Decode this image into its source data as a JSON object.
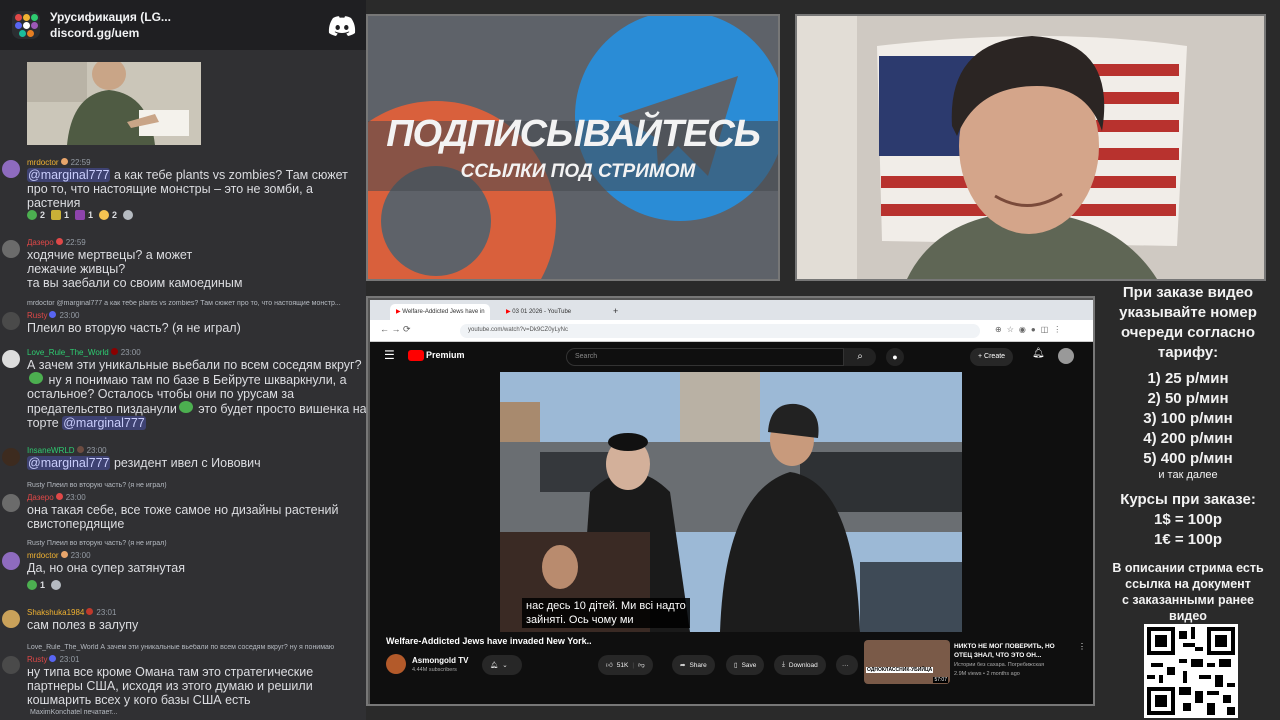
{
  "chat": {
    "server_name": "Урусификация (LG...",
    "invite": "discord.gg/uem",
    "typing": "MaximKonchatel печатает...",
    "messages": [
      {
        "user": "mrdoctor",
        "time": "22:59",
        "color": "#f0b232",
        "mention": "@marginal777",
        "text": " а как тебе plants vs zombies? Там сюжет про то, что настоящие монстры – это не зомби, а растения",
        "reactions": [
          {
            "count": "2"
          },
          {
            "count": "1"
          },
          {
            "count": "1"
          },
          {
            "count": "2"
          }
        ]
      },
      {
        "user": "Дазеро",
        "time": "22:59",
        "color": "#e04848",
        "text": "ходячие мертвецы? а может лежачие живцы?",
        "text2": "та вы заебали со своим камоединым"
      },
      {
        "reply": "mrdoctor @marginal777 а как тебе plants vs zombies? Там сюжет про то, что настоящие монстр...",
        "user": "Rusty",
        "time": "23:00",
        "color": "#e04848",
        "text": "Плеил во вторую часть? (я не играл)"
      },
      {
        "user": "Love_Rule_The_World",
        "time": "23:00",
        "color": "#2ecc71",
        "text": "А зачем эти уникальные вьебали по всем соседям вкруг?",
        "text_b": " ну я понимаю там по базе в Бейруте шкваркнули, а остальное? Осталось чтобы они по урусам за предательство пизданули",
        "text_c": " это будет просто вишенка на торте ",
        "mention": "@marginal777"
      },
      {
        "user": "InsaneWRLD",
        "time": "23:00",
        "color": "#2ecc71",
        "mention": "@marginal777",
        "text": " резидент ивел с Иовович"
      },
      {
        "reply": "Rusty Плеил во вторую часть? (я не играл)",
        "user": "Дазеро",
        "time": "23:00",
        "color": "#e04848",
        "text": "она такая себе, все тоже самое но дизайны растений свистопердящие"
      },
      {
        "reply": "Rusty Плеил во вторую часть? (я не играл)",
        "user": "mrdoctor",
        "time": "23:00",
        "color": "#f0b232",
        "text": "Да, но она супер затянутая",
        "reactions": [
          {
            "count": "1"
          }
        ]
      },
      {
        "user": "Shakshuka1984",
        "time": "23:01",
        "color": "#f0b232",
        "text": "сам полез в залупу"
      },
      {
        "reply": "Love_Rule_The_World А зачем эти уникальные вьебали по всем соседям вкруг? ну я понимаю",
        "user": "Rusty",
        "time": "23:01",
        "color": "#e04848",
        "text": "ну типа все кроме Омана там это стратегические партнеры США, исходя из этого думаю и решили кошмарить всех у кого базы США есть"
      }
    ]
  },
  "banner": {
    "line1": "ПОДПИСЫВАЙТЕСЬ",
    "line2": "ССЫЛКИ ПОД СТРИМОМ"
  },
  "browser": {
    "tab1": "Welfare-Addicted Jews have in",
    "tab2": "03 01 2026 - YouTube",
    "url": "youtube.com/watch?v=Dk9CZ0yLyNc",
    "search_placeholder": "Search",
    "brand": "Premium",
    "create": "Create",
    "subtitle1": "нас десь 10 дітей.  Ми всі надто",
    "subtitle2": "зайняті.  Ось чому ми",
    "video_title": "Welfare-Addicted Jews have invaded New York..",
    "channel": "Asmongold TV",
    "subscribers": "4.44M subscribers",
    "likes": "51K",
    "share": "Share",
    "save": "Save",
    "download": "Download",
    "rec_title": "НИКТО НЕ МОГ ПОВЕРИТЬ, НО ОТЕЦ ЗНАЛ, ЧТО ЭТО ОН...",
    "rec_channel": "Истории без сахара. Погребижская",
    "rec_meta": "2.9M views • 2 months ago",
    "rec_thumb_caption": "ОДНОКЛАССНИК-УБИЙЦА",
    "rec_duration": "57:07"
  },
  "info": {
    "heading": [
      "При заказе видео",
      "указывайте номер",
      "очереди согласно",
      "тарифу:"
    ],
    "prices": [
      "1) 25 р/мин",
      "2) 50 р/мин",
      "3) 100 р/мин",
      "4) 200 р/мин",
      "5) 400 р/мин"
    ],
    "etc": "и так далее",
    "courses_title": "Курсы при заказе:",
    "courses": [
      "1$ = 100р",
      "1€ = 100р"
    ],
    "desc": [
      "В описании стрима есть",
      "ссылка на документ",
      "с заказанными ранее",
      "видео"
    ]
  },
  "colors": {
    "discord": "#5865f2",
    "youtube_red": "#ff0000",
    "mention_bg": "#3e4272"
  }
}
